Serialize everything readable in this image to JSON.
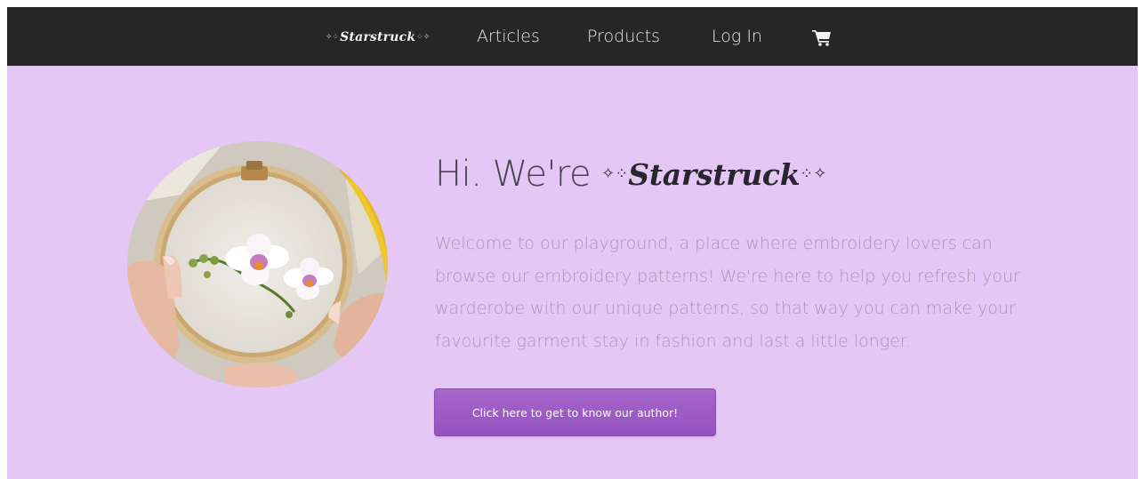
{
  "nav": {
    "logo_text": "Starstruck",
    "links": [
      "Articles",
      "Products",
      "Log In"
    ],
    "cart_icon": "shopping-cart-icon"
  },
  "hero": {
    "title_prefix": "Hi. We're",
    "brand": "Starstruck",
    "description": "Welcome to our playground, a place where embroidery lovers can browse our embroidery patterns! We're here to help you refresh your warderobe with our unique patterns, so that way you can make your favourite garment stay in fashion and last a little longer.",
    "cta_label": "Click here to get to know our author!"
  },
  "colors": {
    "navbar_bg": "#262626",
    "hero_bg": "#e5c7f5",
    "button_bg": "#9b59c6",
    "body_text": "#a798b3"
  }
}
